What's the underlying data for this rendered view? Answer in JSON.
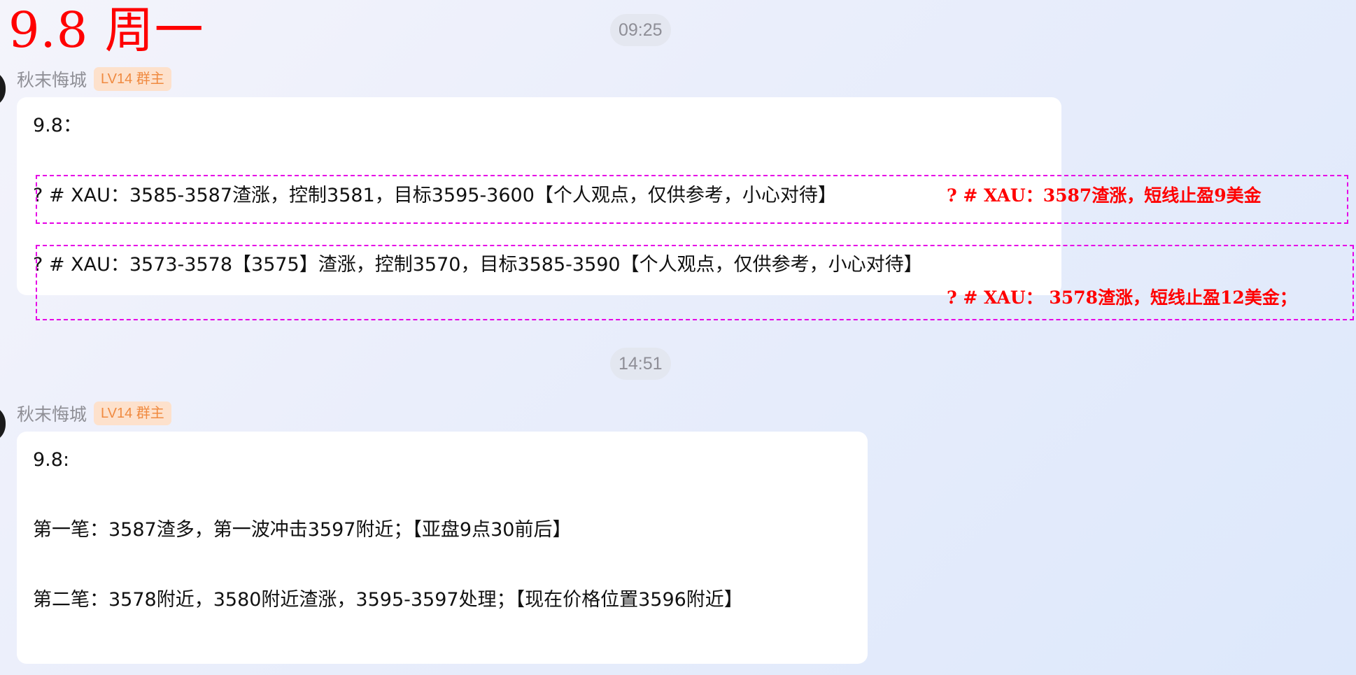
{
  "page_title": "9.8 周一",
  "messages": [
    {
      "time": "09:25",
      "sender": "秋末悔城",
      "badge": "LV14 群主",
      "lines": [
        "9.8：",
        "? # XAU：3585-3587渣涨，控制3581，目标3595-3600【个人观点，仅供参考，小心对待】",
        "? # XAU：3573-3578【3575】渣涨，控制3570，目标3585-3590【个人观点，仅供参考，小心对待】"
      ],
      "annotations": [
        "? # XAU：3587渣涨，短线止盈9美金",
        "? # XAU： 3578渣涨，短线止盈12美金；"
      ]
    },
    {
      "time": "14:51",
      "sender": "秋末悔城",
      "badge": "LV14 群主",
      "lines": [
        "9.8:",
        "第一笔：3587渣多，第一波冲击3597附近；【亚盘9点30前后】",
        "第二笔：3578附近，3580附近渣涨，3595-3597处理；【现在价格位置3596附近】"
      ]
    }
  ]
}
